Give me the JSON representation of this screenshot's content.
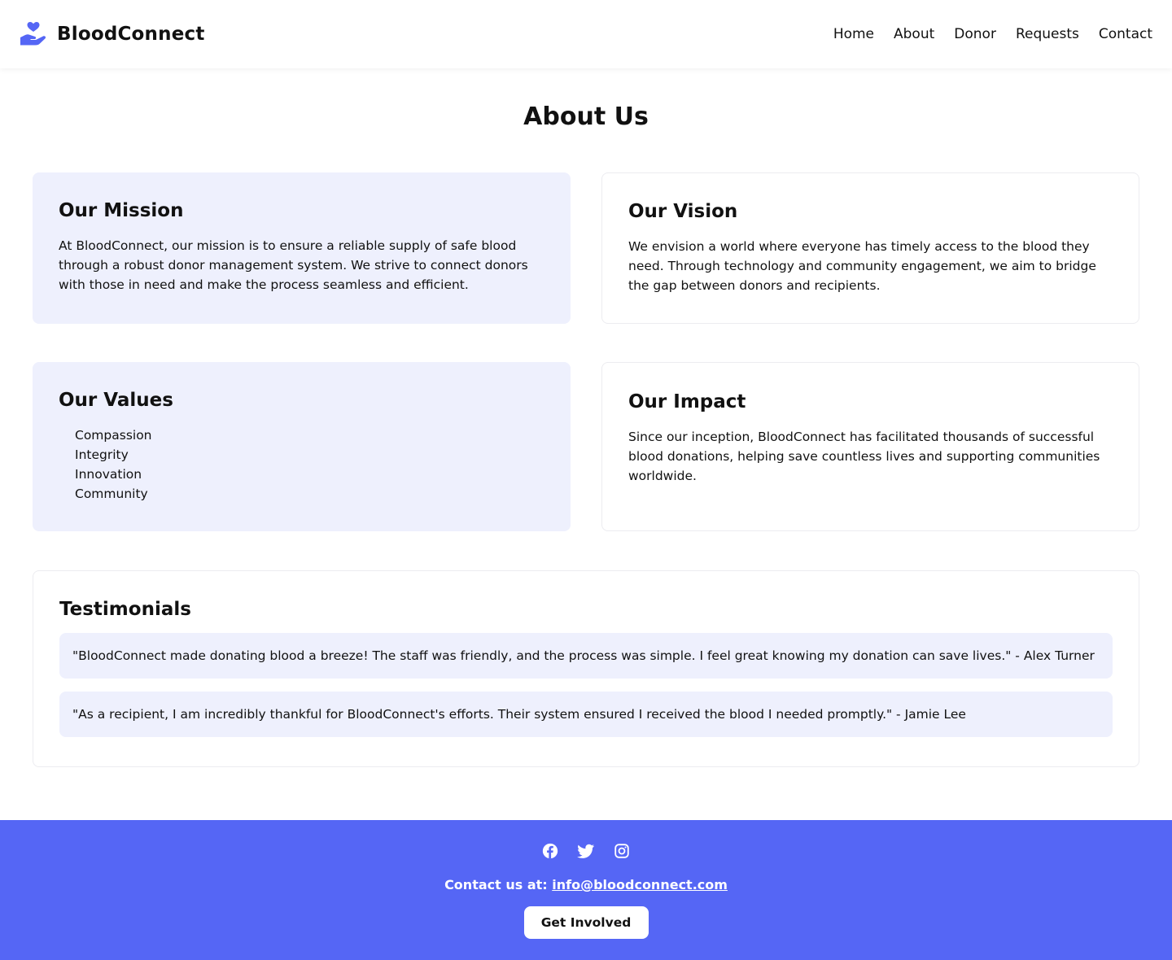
{
  "brand": {
    "name": "BloodConnect",
    "logo_icon": "hand-heart-icon",
    "accent": "#5566f5"
  },
  "nav": {
    "items": [
      "Home",
      "About",
      "Donor",
      "Requests",
      "Contact"
    ]
  },
  "page": {
    "title": "About Us"
  },
  "mission": {
    "title": "Our Mission",
    "text": "At BloodConnect, our mission is to ensure a reliable supply of safe blood through a robust donor management system. We strive to connect donors with those in need and make the process seamless and efficient."
  },
  "vision": {
    "title": "Our Vision",
    "text": "We envision a world where everyone has timely access to the blood they need. Through technology and community engagement, we aim to bridge the gap between donors and recipients."
  },
  "values": {
    "title": "Our Values",
    "items": [
      "Compassion",
      "Integrity",
      "Innovation",
      "Community"
    ]
  },
  "impact": {
    "title": "Our Impact",
    "text": "Since our inception, BloodConnect has facilitated thousands of successful blood donations, helping save countless lives and supporting communities worldwide."
  },
  "testimonials": {
    "title": "Testimonials",
    "items": [
      "\"BloodConnect made donating blood a breeze! The staff was friendly, and the process was simple. I feel great knowing my donation can save lives.\" - Alex Turner",
      "\"As a recipient, I am incredibly thankful for BloodConnect's efforts. Their system ensured I received the blood I needed promptly.\" - Jamie Lee"
    ]
  },
  "footer": {
    "social_icons": [
      "facebook-icon",
      "twitter-icon",
      "instagram-icon"
    ],
    "contact_prefix": "Contact us at:",
    "email": "info@bloodconnect.com",
    "cta_label": "Get Involved",
    "background": "#5566f5"
  }
}
